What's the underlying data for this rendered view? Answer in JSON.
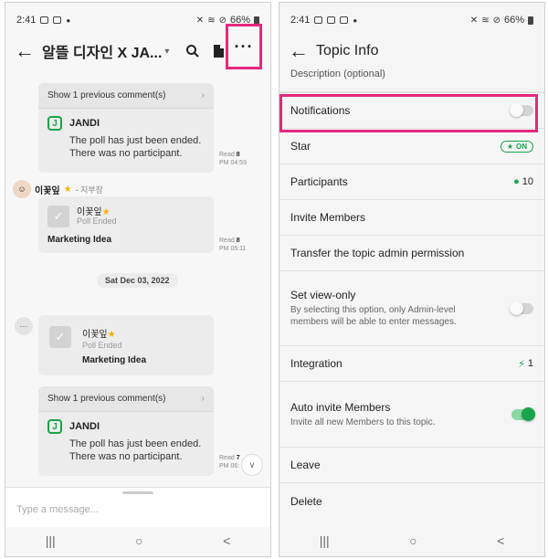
{
  "left": {
    "status": {
      "time": "2:41",
      "battery": "66%"
    },
    "header": {
      "title": "알뜰 디자인 X JA...",
      "title_arrow": "▾",
      "more": "···"
    },
    "comment1": {
      "prev_label": "Show 1 previous comment(s)",
      "bot_name": "JANDI",
      "line1": "The poll has just been ended.",
      "line2": "There was no participant.",
      "read_label": "Read",
      "read_count": "8",
      "time": "PM 04:59"
    },
    "msg1": {
      "sender": "이꽃잎",
      "team": "- 지부장",
      "poll_author": "이꽃잎",
      "poll_status": "Poll Ended",
      "poll_title": "Marketing Idea",
      "read_label": "Read",
      "read_count": "8",
      "time": "PM 05:11"
    },
    "date_divider": "Sat Dec 03, 2022",
    "msg2": {
      "poll_author": "이꽃잎",
      "poll_status": "Poll Ended",
      "poll_title": "Marketing Idea"
    },
    "comment2": {
      "prev_label": "Show 1 previous comment(s)",
      "bot_name": "JANDI",
      "line1": "The poll has just been ended.",
      "line2": "There was no participant.",
      "read_label": "Read",
      "read_count": "7",
      "time": "PM 06:"
    },
    "input": {
      "placeholder": "Type a message..."
    },
    "nav": {
      "recent": "|||",
      "home": "○",
      "back": "<"
    }
  },
  "right": {
    "status": {
      "time": "2:41",
      "battery": "66%"
    },
    "header": {
      "title": "Topic Info"
    },
    "description": "Description (optional)",
    "notifications": {
      "label": "Notifications",
      "on": false
    },
    "star": {
      "label": "Star",
      "badge": "ON"
    },
    "participants": {
      "label": "Participants",
      "count": "10"
    },
    "invite": {
      "label": "Invite Members"
    },
    "transfer": {
      "label": "Transfer the topic admin permission"
    },
    "view_only": {
      "label": "Set view-only",
      "desc1": "By selecting this option, only Admin-level",
      "desc2": "members will be able to enter messages.",
      "on": false
    },
    "integration": {
      "label": "Integration",
      "count": "1"
    },
    "auto_invite": {
      "label": "Auto invite Members",
      "desc": "Invite all new Members to this topic.",
      "on": true
    },
    "leave": {
      "label": "Leave"
    },
    "delete": {
      "label": "Delete"
    },
    "nav": {
      "recent": "|||",
      "home": "○",
      "back": "<"
    }
  },
  "colors": {
    "highlight": "#e6277f",
    "green": "#19a34a",
    "star": "#f5b301"
  }
}
